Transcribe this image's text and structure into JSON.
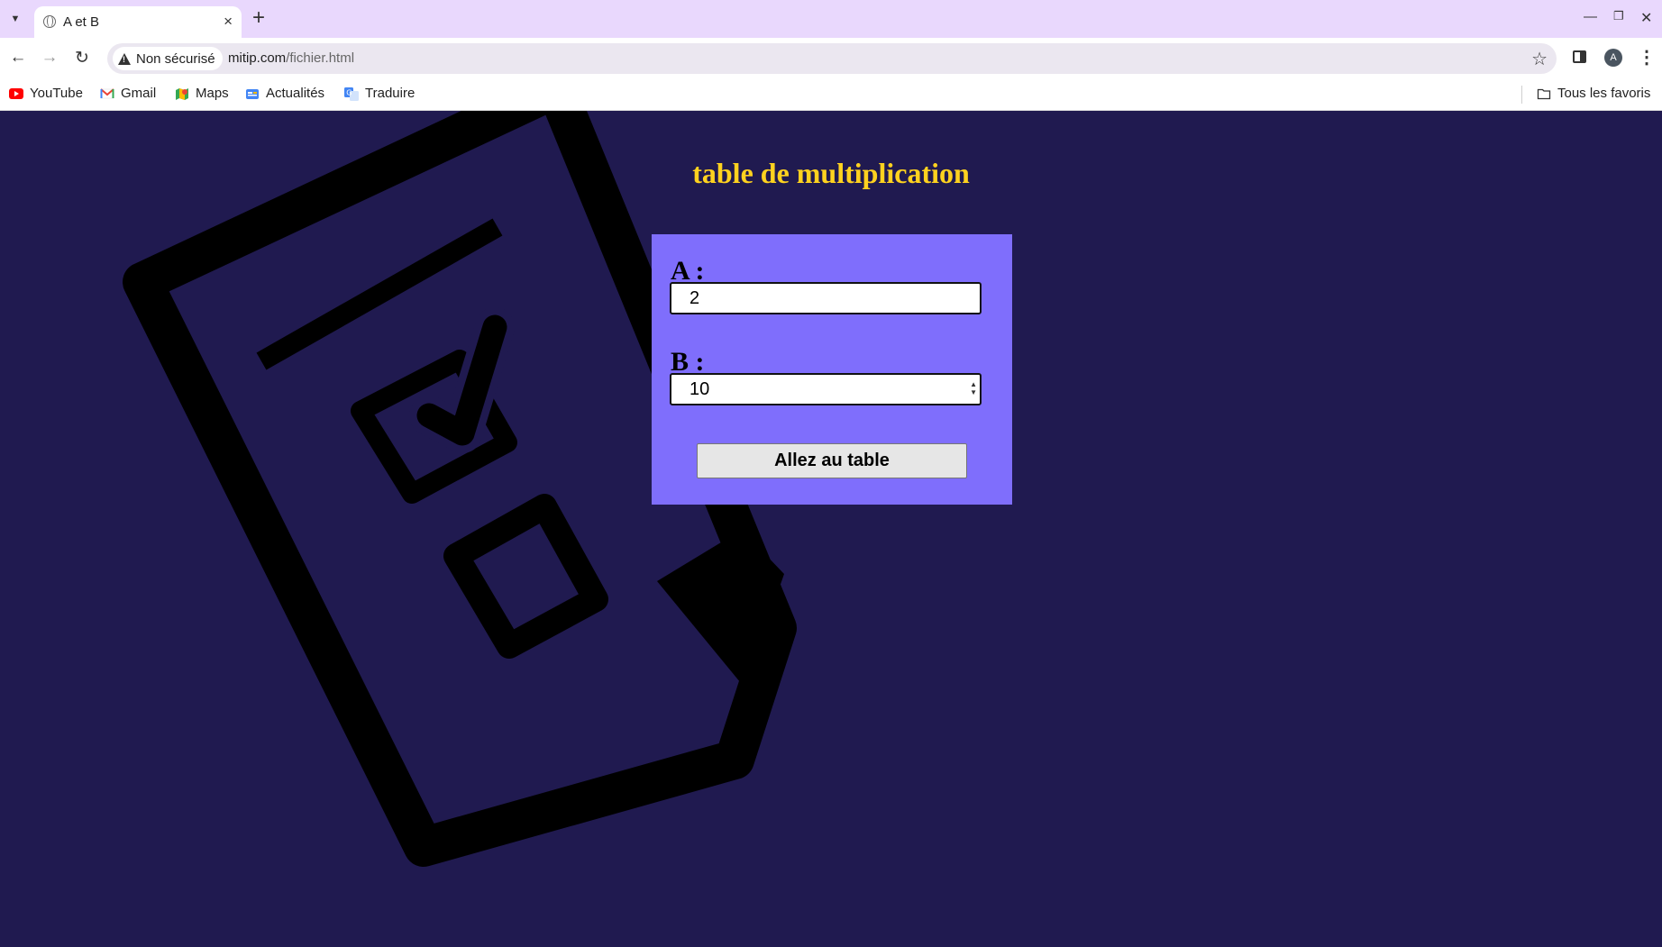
{
  "browser": {
    "tab_title": "A et B",
    "tab_close": "×",
    "new_tab": "+",
    "security_label": "Non sécurisé",
    "url_host": "mitip.com",
    "url_path": "/fichier.html",
    "avatar_letter": "A",
    "bookmarks": [
      {
        "label": "YouTube",
        "icon": "youtube-icon"
      },
      {
        "label": "Gmail",
        "icon": "gmail-icon"
      },
      {
        "label": "Maps",
        "icon": "maps-icon"
      },
      {
        "label": "Actualités",
        "icon": "news-icon"
      },
      {
        "label": "Traduire",
        "icon": "translate-icon"
      }
    ],
    "all_bookmarks_label": "Tous les favoris"
  },
  "page": {
    "title": "table de multiplication",
    "label_a": "A :",
    "value_a": "2",
    "label_b": "B :",
    "value_b": "10",
    "submit_label": "Allez au table"
  },
  "colors": {
    "page_background": "#201a50",
    "title": "#ffd21f",
    "form_background": "#7f6efc",
    "tab_strip": "#e9d8fd"
  }
}
